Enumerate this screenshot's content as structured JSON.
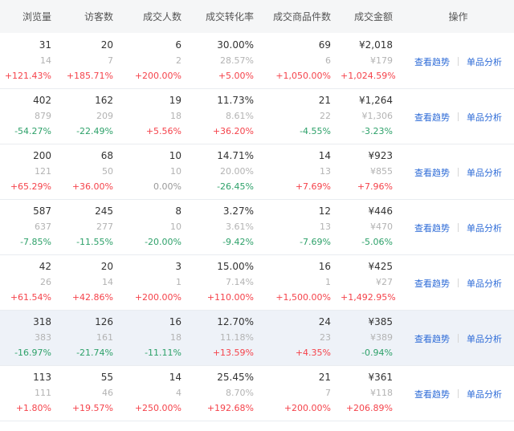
{
  "headers": [
    "浏览量",
    "访客数",
    "成交人数",
    "成交转化率",
    "成交商品件数",
    "成交金额",
    "操作"
  ],
  "actions": {
    "trend": "查看趋势",
    "analysis": "单品分析"
  },
  "rows": [
    {
      "highlight": false,
      "cells": [
        {
          "cur": "31",
          "prev": "14",
          "chg": "+121.43%",
          "dir": "up"
        },
        {
          "cur": "20",
          "prev": "7",
          "chg": "+185.71%",
          "dir": "up"
        },
        {
          "cur": "6",
          "prev": "2",
          "chg": "+200.00%",
          "dir": "up"
        },
        {
          "cur": "30.00%",
          "prev": "28.57%",
          "chg": "+5.00%",
          "dir": "up"
        },
        {
          "cur": "69",
          "prev": "6",
          "chg": "+1,050.00%",
          "dir": "up"
        },
        {
          "cur": "¥2,018",
          "prev": "¥179",
          "chg": "+1,024.59%",
          "dir": "up"
        }
      ]
    },
    {
      "highlight": false,
      "cells": [
        {
          "cur": "402",
          "prev": "879",
          "chg": "-54.27%",
          "dir": "down"
        },
        {
          "cur": "162",
          "prev": "209",
          "chg": "-22.49%",
          "dir": "down"
        },
        {
          "cur": "19",
          "prev": "18",
          "chg": "+5.56%",
          "dir": "up"
        },
        {
          "cur": "11.73%",
          "prev": "8.61%",
          "chg": "+36.20%",
          "dir": "up"
        },
        {
          "cur": "21",
          "prev": "22",
          "chg": "-4.55%",
          "dir": "down"
        },
        {
          "cur": "¥1,264",
          "prev": "¥1,306",
          "chg": "-3.23%",
          "dir": "down"
        }
      ]
    },
    {
      "highlight": false,
      "cells": [
        {
          "cur": "200",
          "prev": "121",
          "chg": "+65.29%",
          "dir": "up"
        },
        {
          "cur": "68",
          "prev": "50",
          "chg": "+36.00%",
          "dir": "up"
        },
        {
          "cur": "10",
          "prev": "10",
          "chg": "0.00%",
          "dir": "zero"
        },
        {
          "cur": "14.71%",
          "prev": "20.00%",
          "chg": "-26.45%",
          "dir": "down"
        },
        {
          "cur": "14",
          "prev": "13",
          "chg": "+7.69%",
          "dir": "up"
        },
        {
          "cur": "¥923",
          "prev": "¥855",
          "chg": "+7.96%",
          "dir": "up"
        }
      ]
    },
    {
      "highlight": false,
      "cells": [
        {
          "cur": "587",
          "prev": "637",
          "chg": "-7.85%",
          "dir": "down"
        },
        {
          "cur": "245",
          "prev": "277",
          "chg": "-11.55%",
          "dir": "down"
        },
        {
          "cur": "8",
          "prev": "10",
          "chg": "-20.00%",
          "dir": "down"
        },
        {
          "cur": "3.27%",
          "prev": "3.61%",
          "chg": "-9.42%",
          "dir": "down"
        },
        {
          "cur": "12",
          "prev": "13",
          "chg": "-7.69%",
          "dir": "down"
        },
        {
          "cur": "¥446",
          "prev": "¥470",
          "chg": "-5.06%",
          "dir": "down"
        }
      ]
    },
    {
      "highlight": false,
      "cells": [
        {
          "cur": "42",
          "prev": "26",
          "chg": "+61.54%",
          "dir": "up"
        },
        {
          "cur": "20",
          "prev": "14",
          "chg": "+42.86%",
          "dir": "up"
        },
        {
          "cur": "3",
          "prev": "1",
          "chg": "+200.00%",
          "dir": "up"
        },
        {
          "cur": "15.00%",
          "prev": "7.14%",
          "chg": "+110.00%",
          "dir": "up"
        },
        {
          "cur": "16",
          "prev": "1",
          "chg": "+1,500.00%",
          "dir": "up"
        },
        {
          "cur": "¥425",
          "prev": "¥27",
          "chg": "+1,492.95%",
          "dir": "up"
        }
      ]
    },
    {
      "highlight": true,
      "cells": [
        {
          "cur": "318",
          "prev": "383",
          "chg": "-16.97%",
          "dir": "down"
        },
        {
          "cur": "126",
          "prev": "161",
          "chg": "-21.74%",
          "dir": "down"
        },
        {
          "cur": "16",
          "prev": "18",
          "chg": "-11.11%",
          "dir": "down"
        },
        {
          "cur": "12.70%",
          "prev": "11.18%",
          "chg": "+13.59%",
          "dir": "up"
        },
        {
          "cur": "24",
          "prev": "23",
          "chg": "+4.35%",
          "dir": "up"
        },
        {
          "cur": "¥385",
          "prev": "¥389",
          "chg": "-0.94%",
          "dir": "down"
        }
      ]
    },
    {
      "highlight": false,
      "cells": [
        {
          "cur": "113",
          "prev": "111",
          "chg": "+1.80%",
          "dir": "up"
        },
        {
          "cur": "55",
          "prev": "46",
          "chg": "+19.57%",
          "dir": "up"
        },
        {
          "cur": "14",
          "prev": "4",
          "chg": "+250.00%",
          "dir": "up"
        },
        {
          "cur": "25.45%",
          "prev": "8.70%",
          "chg": "+192.68%",
          "dir": "up"
        },
        {
          "cur": "21",
          "prev": "7",
          "chg": "+200.00%",
          "dir": "up"
        },
        {
          "cur": "¥361",
          "prev": "¥118",
          "chg": "+206.89%",
          "dir": "up"
        }
      ]
    }
  ]
}
